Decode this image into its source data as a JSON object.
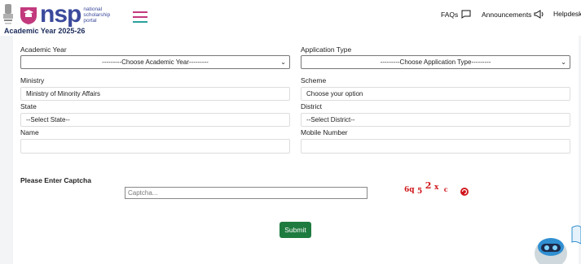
{
  "header": {
    "logo_text": "nsp",
    "logo_sub": [
      "national",
      "scholarship",
      "portal"
    ],
    "academic_year": "Academic Year 2025-26",
    "nav": {
      "faqs": "FAQs",
      "announcements": "Announcements",
      "helpdesk": "Helpdesk"
    }
  },
  "form": {
    "academic_year": {
      "label": "Academic Year",
      "value": "---------Choose Academic Year---------"
    },
    "application_type": {
      "label": "Application Type",
      "value": "---------Choose Application Type---------"
    },
    "ministry": {
      "label": "Ministry",
      "value": "Ministry of Minority Affairs"
    },
    "scheme": {
      "label": "Scheme",
      "value": "Choose your option"
    },
    "state": {
      "label": "State",
      "value": "--Select State--"
    },
    "district": {
      "label": "District",
      "value": "--Select District--"
    },
    "name": {
      "label": "Name",
      "value": ""
    },
    "mobile": {
      "label": "Mobile Number",
      "value": ""
    },
    "captcha": {
      "label": "Please Enter Captcha",
      "placeholder": "Captcha...",
      "image_text": "6q 5 2 x c"
    },
    "submit_label": "Submit"
  },
  "colors": {
    "brand": "#3b4a9c",
    "submit": "#1e7b3f",
    "captcha": "#d0161b"
  }
}
